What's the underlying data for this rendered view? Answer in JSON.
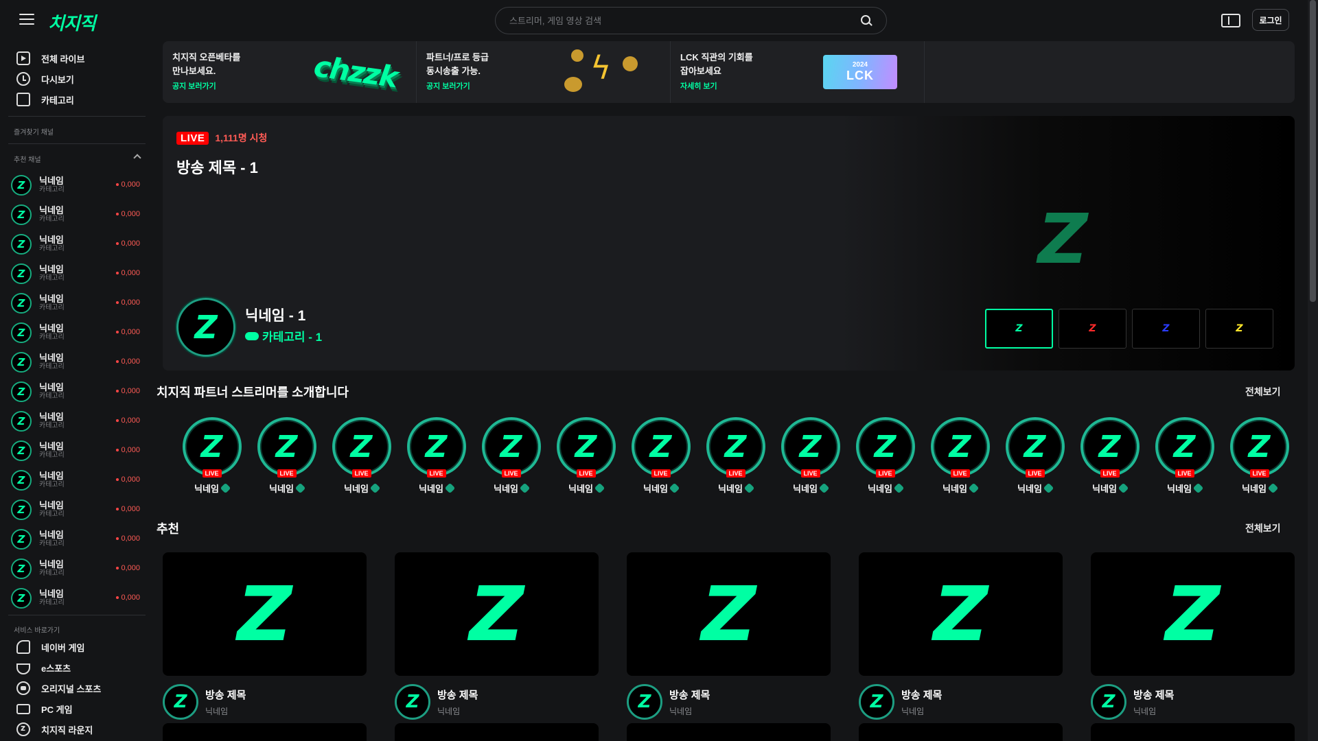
{
  "header": {
    "logo": "치지직",
    "search_placeholder": "스트리머, 게임 영상 검색",
    "login_label": "로그인"
  },
  "sidebar": {
    "nav": [
      {
        "label": "전체 라이브",
        "icon": "live-icon"
      },
      {
        "label": "다시보기",
        "icon": "replay-icon"
      },
      {
        "label": "카테고리",
        "icon": "category-icon"
      }
    ],
    "favorites_label": "즐겨찾기 채널",
    "recommended_label": "추천 채널",
    "channels": [
      {
        "name": "닉네임",
        "category": "카테고리",
        "viewers": "0,000"
      },
      {
        "name": "닉네임",
        "category": "카테고리",
        "viewers": "0,000"
      },
      {
        "name": "닉네임",
        "category": "카테고리",
        "viewers": "0,000"
      },
      {
        "name": "닉네임",
        "category": "카테고리",
        "viewers": "0,000"
      },
      {
        "name": "닉네임",
        "category": "카테고리",
        "viewers": "0,000"
      },
      {
        "name": "닉네임",
        "category": "카테고리",
        "viewers": "0,000"
      },
      {
        "name": "닉네임",
        "category": "카테고리",
        "viewers": "0,000"
      },
      {
        "name": "닉네임",
        "category": "카테고리",
        "viewers": "0,000"
      },
      {
        "name": "닉네임",
        "category": "카테고리",
        "viewers": "0,000"
      },
      {
        "name": "닉네임",
        "category": "카테고리",
        "viewers": "0,000"
      },
      {
        "name": "닉네임",
        "category": "카테고리",
        "viewers": "0,000"
      },
      {
        "name": "닉네임",
        "category": "카테고리",
        "viewers": "0,000"
      },
      {
        "name": "닉네임",
        "category": "카테고리",
        "viewers": "0,000"
      },
      {
        "name": "닉네임",
        "category": "카테고리",
        "viewers": "0,000"
      },
      {
        "name": "닉네임",
        "category": "카테고리",
        "viewers": "0,000"
      }
    ],
    "services_label": "서비스 바로가기",
    "services": [
      {
        "label": "네이버 게임",
        "icon": "game-icon"
      },
      {
        "label": "e스포츠",
        "icon": "trophy-icon"
      },
      {
        "label": "오리지널 스포츠",
        "icon": "ball-icon"
      },
      {
        "label": "PC 게임",
        "icon": "pc-icon"
      },
      {
        "label": "치지직 라운지",
        "icon": "lounge-icon"
      }
    ]
  },
  "banners": [
    {
      "text": "치지직 오픈베타를\n만나보세요.",
      "link": "공지 보러가기",
      "art": "chzzk"
    },
    {
      "text": "파트너/프로 등급\n동시송출 가능.",
      "link": "공지 보러가기",
      "art": ""
    },
    {
      "text": "LCK 직관의 기회를\n잡아보세요",
      "link": "자세히 보기",
      "art_year": "2024",
      "art_title": "LCK"
    }
  ],
  "hero": {
    "live_badge": "LIVE",
    "viewers": "1,111명 시청",
    "title": "방송 제목 - 1",
    "nickname": "닉네임 - 1",
    "category": "카테고리 - 1",
    "thumb_colors": [
      "#00ffa3",
      "#ff2a2a",
      "#2a3cff",
      "#ffe62a"
    ]
  },
  "partners_section": {
    "title": "치지직 파트너 스트리머를 소개합니다",
    "see_all": "전체보기",
    "live_badge": "LIVE",
    "names": [
      "닉네임",
      "닉네임",
      "닉네임",
      "닉네임",
      "닉네임",
      "닉네임",
      "닉네임",
      "닉네임",
      "닉네임",
      "닉네임",
      "닉네임",
      "닉네임",
      "닉네임",
      "닉네임",
      "닉네임"
    ]
  },
  "recommend_section": {
    "title": "추천",
    "see_all": "전체보기",
    "items": [
      {
        "title": "방송 제목",
        "nickname": "닉네임"
      },
      {
        "title": "방송 제목",
        "nickname": "닉네임"
      },
      {
        "title": "방송 제목",
        "nickname": "닉네임"
      },
      {
        "title": "방송 제목",
        "nickname": "닉네임"
      },
      {
        "title": "방송 제목",
        "nickname": "닉네임"
      }
    ]
  },
  "colors": {
    "accent": "#00ffa3",
    "live": "#ff0000",
    "background": "#141517"
  }
}
